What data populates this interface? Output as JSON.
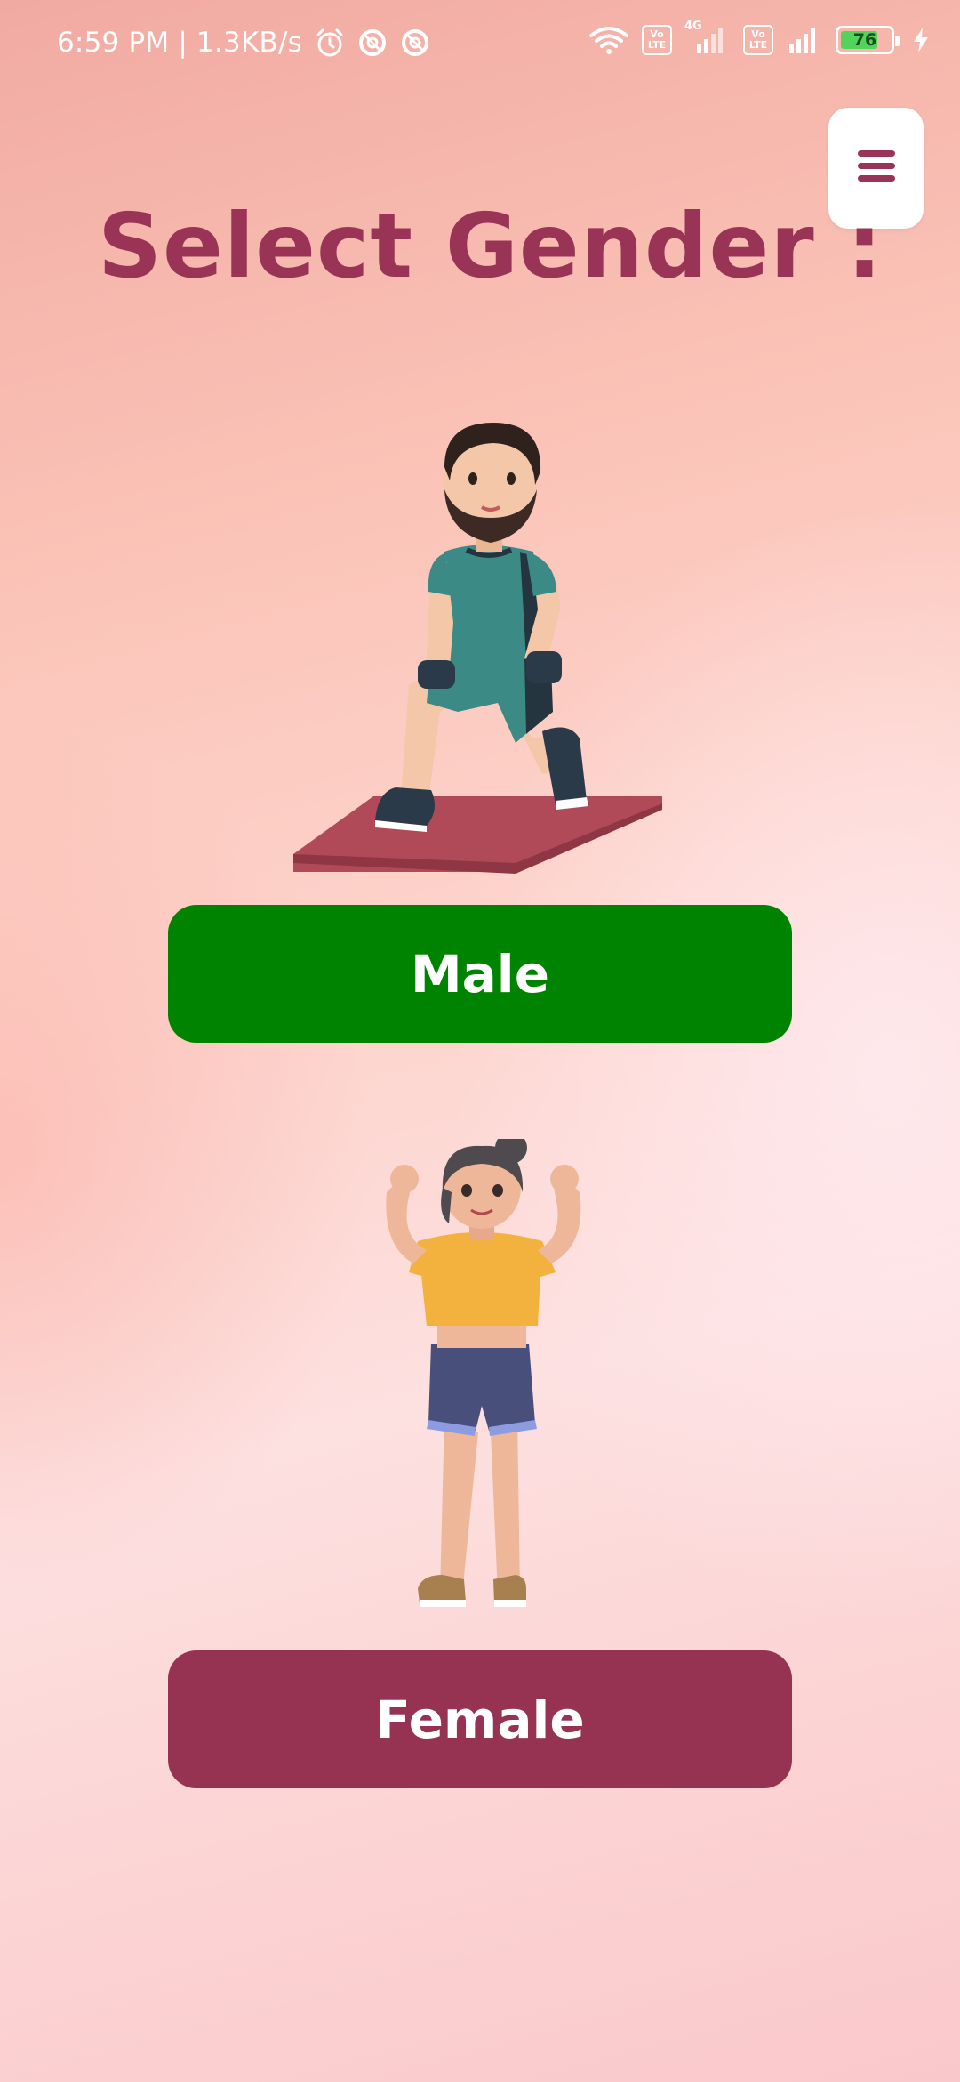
{
  "status_bar": {
    "time": "6:59 PM | 1.3KB/s",
    "icons": [
      "alarm-icon",
      "notification-block-icon",
      "notification-block-icon",
      "wifi-icon",
      "volte-icon",
      "signal-4g-icon",
      "volte-icon",
      "signal-icon",
      "battery-icon",
      "charging-icon"
    ],
    "volte_label_top": "Vo",
    "volte_label_bottom": "LTE",
    "network_label": "4G",
    "battery_level": "76",
    "battery_fraction": 0.76
  },
  "header": {
    "menu_icon": "menu-icon",
    "title": "Select Gender :"
  },
  "options": {
    "male_label": "Male",
    "female_label": "Female"
  },
  "colors": {
    "title": "#9a3457",
    "male_button": "#008300",
    "female_button": "#963252",
    "button_text": "#ffffff"
  }
}
